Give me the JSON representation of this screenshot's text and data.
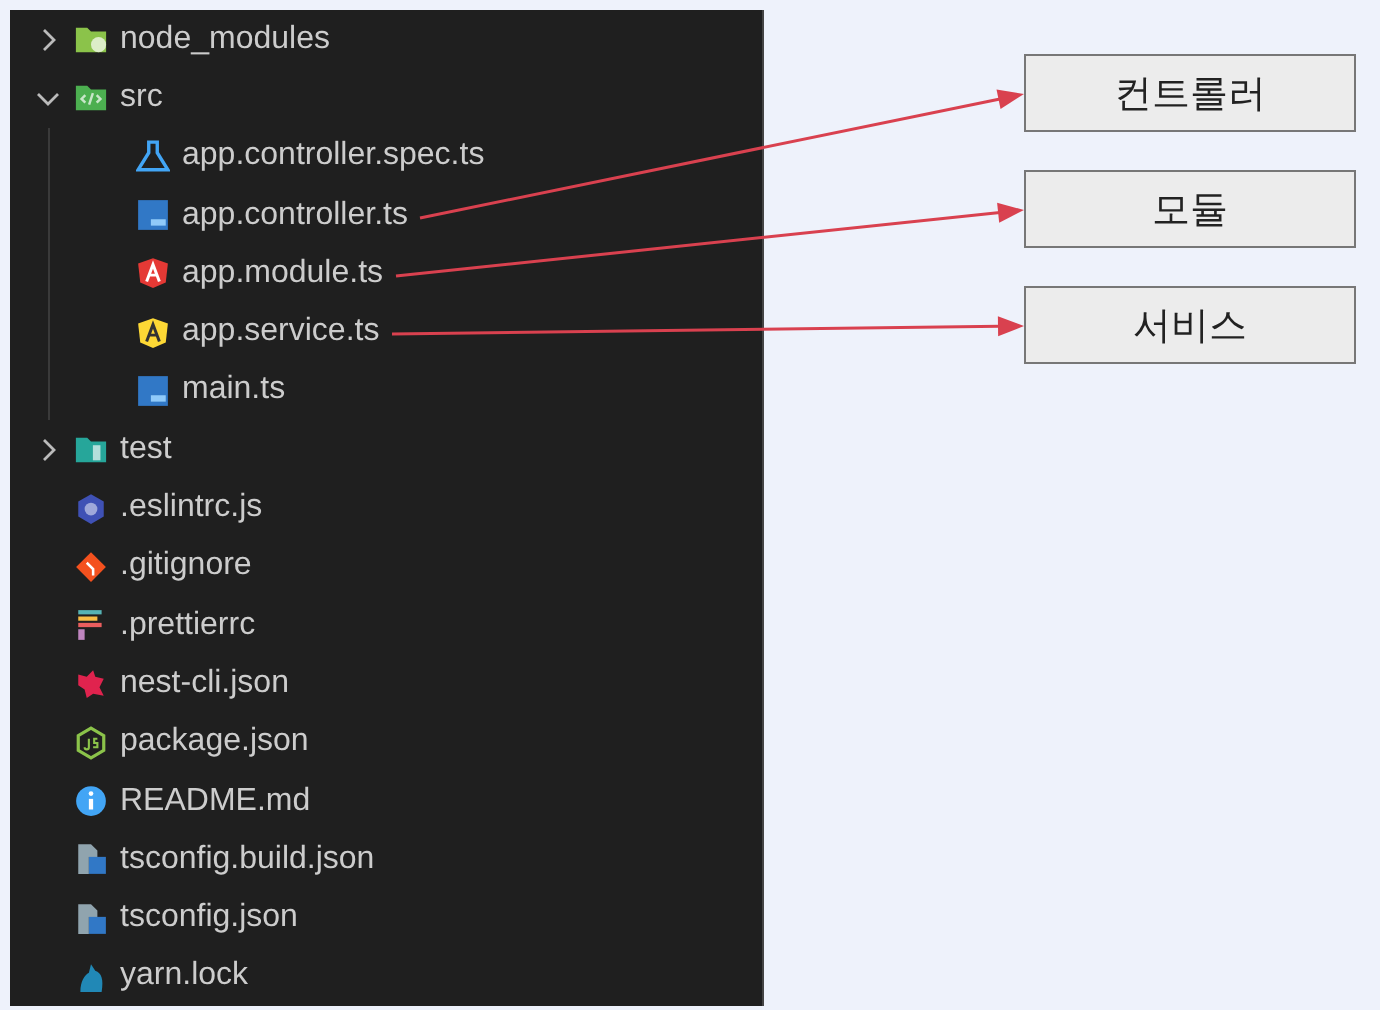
{
  "explorer": {
    "items": [
      {
        "name": "node_modules",
        "kind": "folder-modules",
        "expanded": false
      },
      {
        "name": "src",
        "kind": "folder-src",
        "expanded": true,
        "children": [
          {
            "name": "app.controller.spec.ts",
            "kind": "test"
          },
          {
            "name": "app.controller.ts",
            "kind": "typescript",
            "annotation": "컨트롤러"
          },
          {
            "name": "app.module.ts",
            "kind": "module",
            "annotation": "모듈"
          },
          {
            "name": "app.service.ts",
            "kind": "service",
            "annotation": "서비스"
          },
          {
            "name": "main.ts",
            "kind": "typescript"
          }
        ]
      },
      {
        "name": "test",
        "kind": "folder-test",
        "expanded": false
      },
      {
        "name": ".eslintrc.js",
        "kind": "eslint"
      },
      {
        "name": ".gitignore",
        "kind": "git"
      },
      {
        "name": ".prettierrc",
        "kind": "prettier"
      },
      {
        "name": "nest-cli.json",
        "kind": "nest"
      },
      {
        "name": "package.json",
        "kind": "node"
      },
      {
        "name": "README.md",
        "kind": "info"
      },
      {
        "name": "tsconfig.build.json",
        "kind": "tsconfig"
      },
      {
        "name": "tsconfig.json",
        "kind": "tsconfig"
      },
      {
        "name": "yarn.lock",
        "kind": "yarn"
      }
    ]
  }
}
